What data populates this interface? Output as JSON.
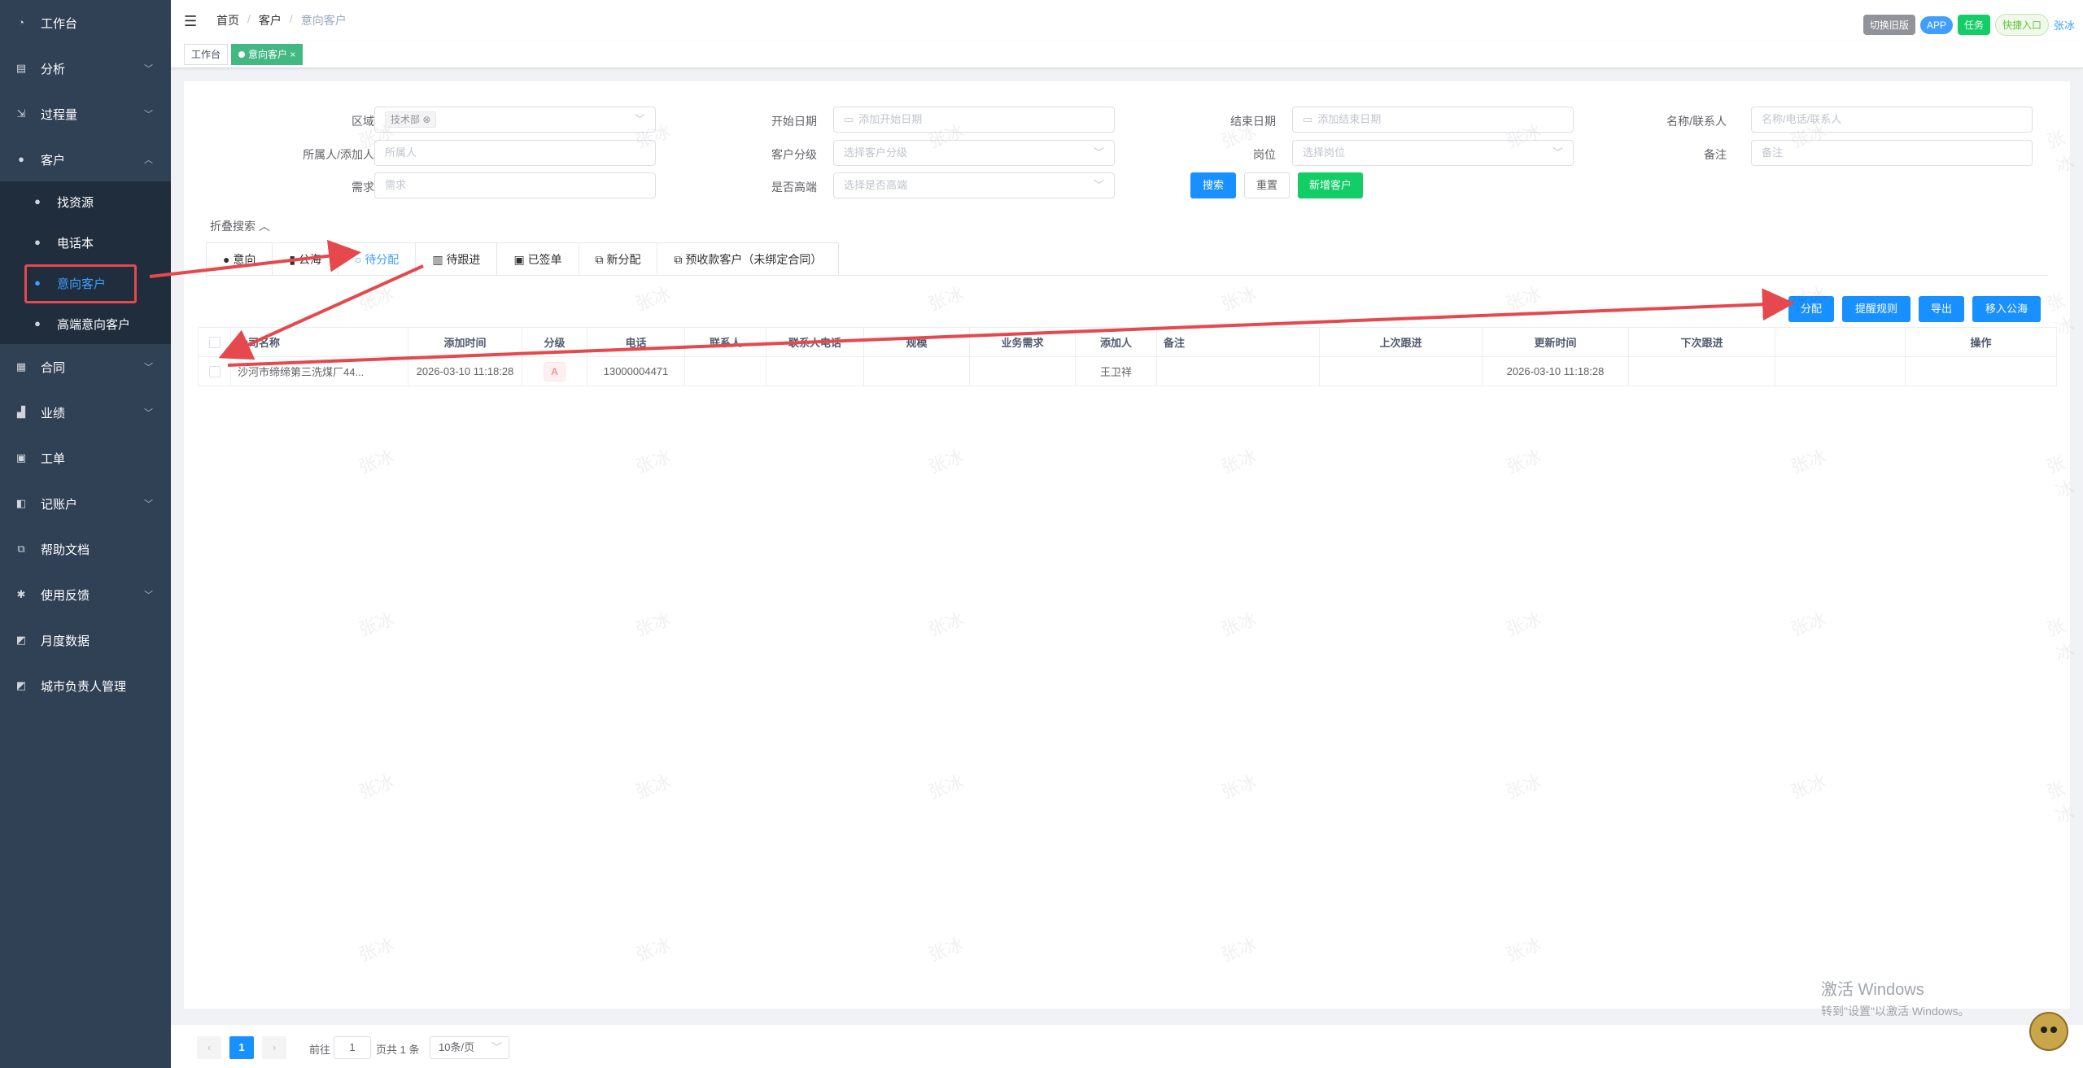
{
  "sidebar": {
    "items": [
      {
        "label": "工作台",
        "icon": "dashboard-icon"
      },
      {
        "label": "分析",
        "icon": "chart-icon"
      },
      {
        "label": "过程量",
        "icon": "process-icon"
      },
      {
        "label": "客户",
        "icon": "user-icon"
      },
      {
        "label": "合同",
        "icon": "contract-icon"
      },
      {
        "label": "业绩",
        "icon": "performance-icon"
      },
      {
        "label": "工单",
        "icon": "clipboard-icon"
      },
      {
        "label": "记账户",
        "icon": "ledger-icon"
      },
      {
        "label": "帮助文档",
        "icon": "external-link-icon"
      },
      {
        "label": "使用反馈",
        "icon": "bug-icon"
      },
      {
        "label": "月度数据",
        "icon": "monthly-chart-icon"
      },
      {
        "label": "城市负责人管理",
        "icon": "city-manager-icon"
      }
    ],
    "sub_items": [
      {
        "label": "找资源"
      },
      {
        "label": "电话本"
      },
      {
        "label": "意向客户"
      },
      {
        "label": "高端意向客户"
      }
    ]
  },
  "header": {
    "breadcrumb": [
      "首页",
      "客户",
      "意向客户"
    ],
    "btn_old": "切换旧版",
    "btn_app": "APP",
    "btn_task": "任务",
    "btn_quick": "快捷入口",
    "user": "张冰"
  },
  "tagsview": {
    "tag1": "工作台",
    "tag2": "意向客户",
    "close": "×"
  },
  "filters": {
    "region_label": "区域",
    "region_chip": "技术部",
    "start_label": "开始日期",
    "start_ph": "添加开始日期",
    "end_label": "结束日期",
    "end_ph": "添加结束日期",
    "name_label": "名称/联系人",
    "name_ph": "名称/电话/联系人",
    "owner_label": "所属人/添加人",
    "owner_ph": "所属人",
    "grade_label": "客户分级",
    "grade_ph": "选择客户分级",
    "post_label": "岗位",
    "post_ph": "选择岗位",
    "remark_label": "备注",
    "remark_ph": "备注",
    "need_label": "需求",
    "need_ph": "需求",
    "highend_label": "是否高端",
    "highend_ph": "选择是否高端",
    "search_btn": "搜索",
    "reset_btn": "重置",
    "new_btn": "新增客户",
    "collapse": "折叠搜索"
  },
  "tabs": [
    "意向",
    "公海",
    "待分配",
    "待跟进",
    "已签单",
    "新分配",
    "预收款客户（未绑定合同）"
  ],
  "actions": {
    "assign": "分配",
    "remind": "提醒规则",
    "export": "导出",
    "sea": "移入公海"
  },
  "table": {
    "headers": [
      "公司名称",
      "添加时间",
      "分级",
      "电话",
      "联系人",
      "联系人电话",
      "规模",
      "业务需求",
      "添加人",
      "备注",
      "上次跟进",
      "更新时间",
      "下次跟进",
      "",
      "操作"
    ],
    "rows": [
      {
        "company": "沙河市缔缔第三洗煤厂44...",
        "added": "2026-03-10 11:18:28",
        "level": "A",
        "phone": "13000004471",
        "contact": "",
        "contact_phone": "",
        "scale": "",
        "need": "",
        "adder": "王卫祥",
        "remark": "",
        "last": "",
        "updated": "2026-03-10 11:18:28",
        "next": "",
        "extra": "",
        "op": ""
      }
    ]
  },
  "pager": {
    "current": "1",
    "goto": "前往",
    "goto_val": "1",
    "total": "页共 1 条",
    "size": "10条/页"
  },
  "watermark": "张冰",
  "windows": {
    "line1": "激活 Windows",
    "line2": "转到\"设置\"以激活 Windows。"
  }
}
